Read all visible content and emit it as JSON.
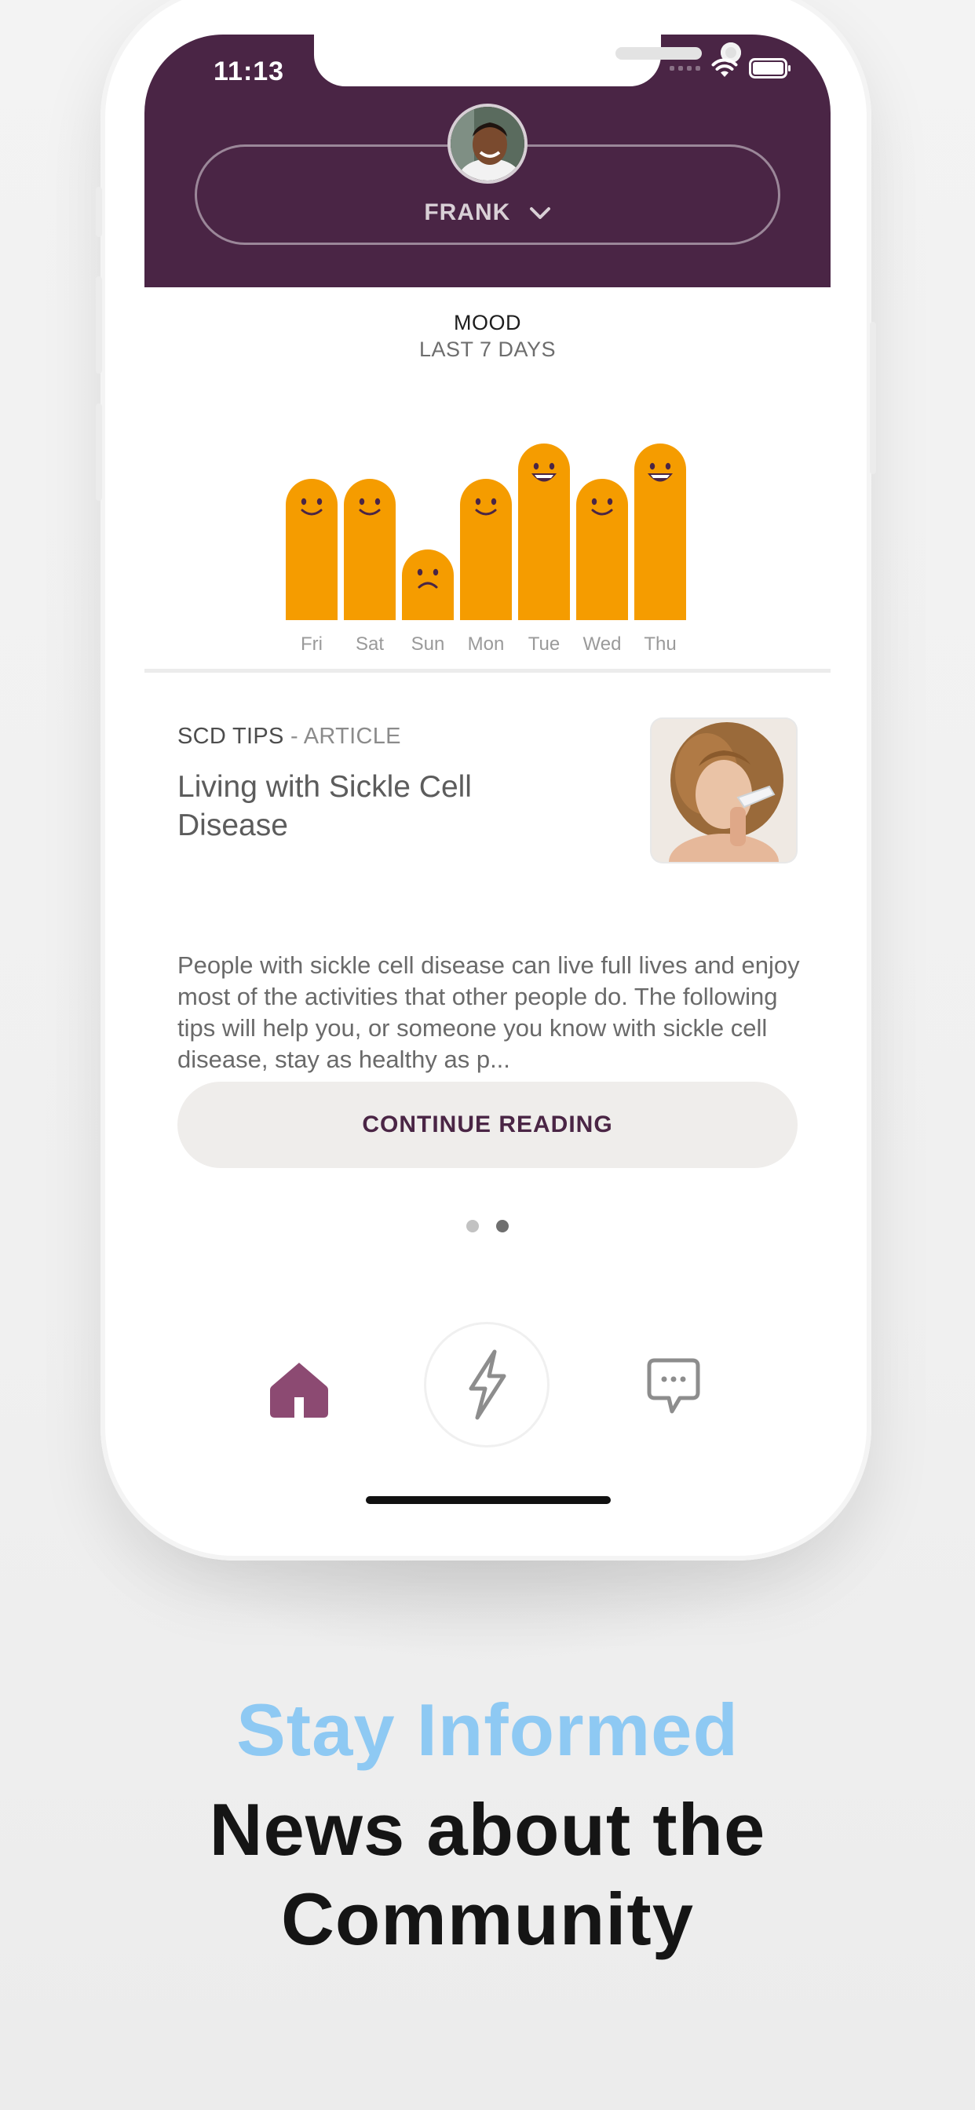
{
  "status_bar": {
    "time": "11:13"
  },
  "profile": {
    "name": "FRANK"
  },
  "mood": {
    "title": "MOOD",
    "subtitle": "LAST 7 DAYS"
  },
  "chart_data": {
    "type": "bar",
    "categories": [
      "Fri",
      "Sat",
      "Sun",
      "Mon",
      "Tue",
      "Wed",
      "Thu"
    ],
    "values": [
      4,
      4,
      2,
      4,
      5,
      4,
      5
    ],
    "faces": [
      "smile",
      "smile",
      "sad",
      "smile",
      "grin",
      "smile",
      "grin"
    ],
    "ylim": [
      0,
      5
    ],
    "bar_color": "#f59c00",
    "grid": false
  },
  "article": {
    "category": "SCD TIPS",
    "separator": "-",
    "type": "ARTICLE",
    "title": "Living with Sickle Cell Disease",
    "body": "People with sickle cell disease can live full lives and enjoy most of the activities that other people do. The following tips will help you, or someone you know with sickle cell disease, stay as healthy as p...",
    "cta": "CONTINUE READING"
  },
  "pagination": {
    "count": 2,
    "active_index": 1
  },
  "tab_bar": {
    "items": [
      {
        "icon": "home-icon",
        "active": true
      },
      {
        "icon": "lightning-icon",
        "active": false
      },
      {
        "icon": "chat-bubble-icon",
        "active": false
      }
    ]
  },
  "caption": {
    "tagline": "Stay Informed",
    "headline": "News about the Community"
  },
  "colors": {
    "brand_purple": "#4a2545",
    "mood_orange": "#f59c00",
    "active_tab": "#8c4a72",
    "tagline_blue": "#8ec9f3"
  }
}
